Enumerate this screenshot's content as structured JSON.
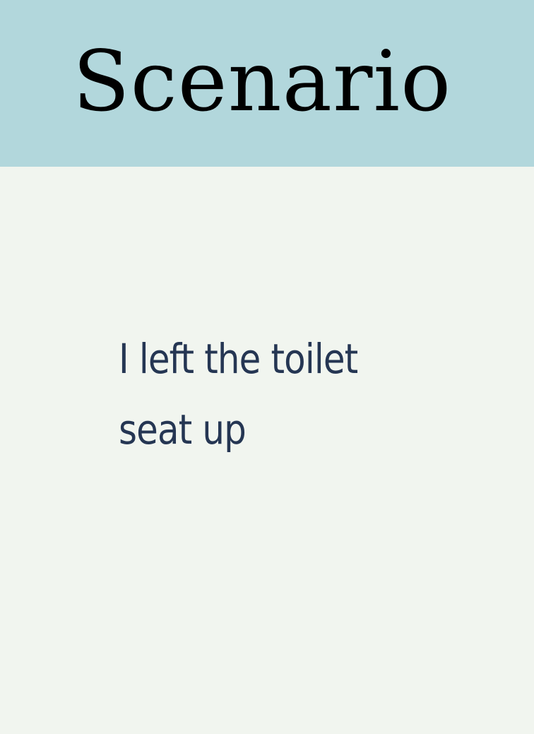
{
  "card": {
    "title": "Scenario",
    "text": "I left the toilet seat up"
  },
  "colors": {
    "header_background": "#b2d7dc",
    "body_background": "#f1f5ef",
    "title_color": "#000000",
    "text_color": "#253653"
  }
}
